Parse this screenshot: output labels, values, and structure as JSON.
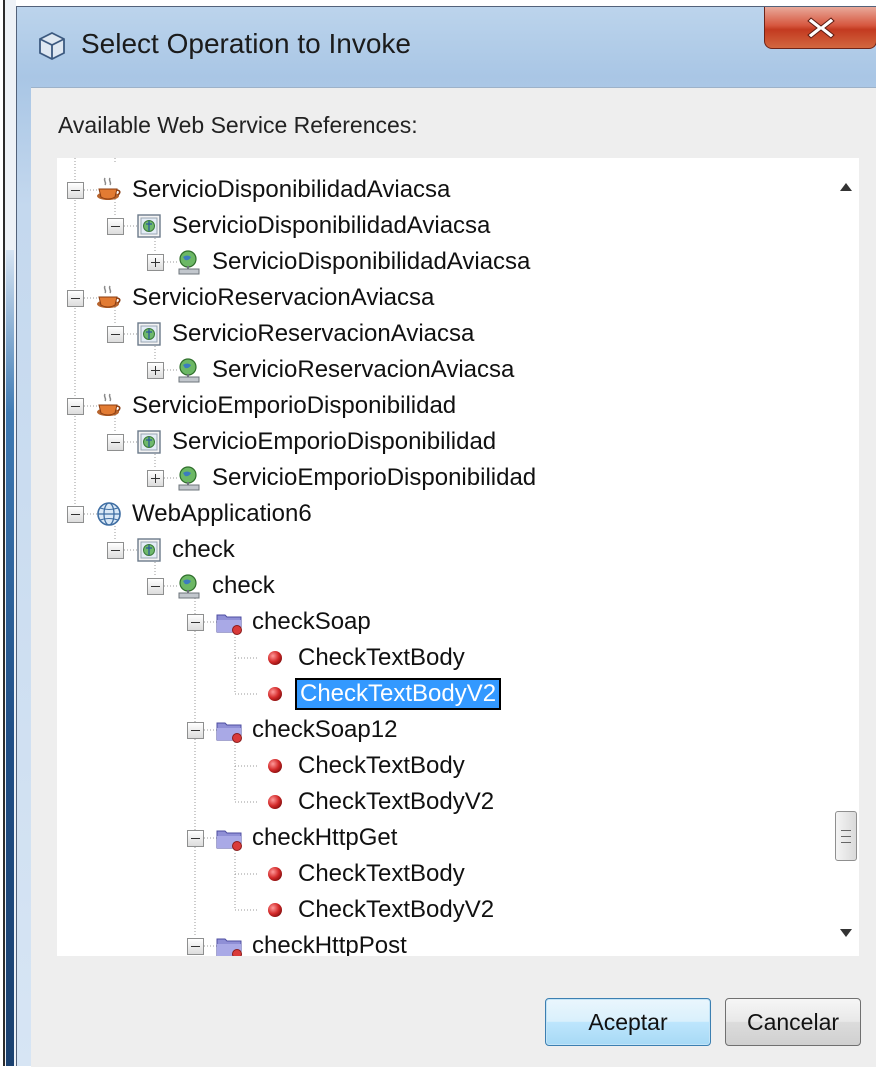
{
  "window": {
    "title": "Select Operation to Invoke",
    "title_icon": "netbeans-cube-icon",
    "close_icon": "close-x-icon"
  },
  "panel": {
    "label": "Available Web Service References:"
  },
  "tree": {
    "rows": [
      {
        "label": "ServicioDisponibilidadAviacsa",
        "icon": "coffee-cup-icon",
        "depth": 0,
        "expanded": true
      },
      {
        "label": "ServicioDisponibilidadAviacsa",
        "icon": "service-icon",
        "depth": 1,
        "expanded": true
      },
      {
        "label": "ServicioDisponibilidadAviacsa",
        "icon": "port-icon",
        "depth": 2,
        "expanded": false
      },
      {
        "label": "ServicioReservacionAviacsa",
        "icon": "coffee-cup-icon",
        "depth": 0,
        "expanded": true
      },
      {
        "label": "ServicioReservacionAviacsa",
        "icon": "service-icon",
        "depth": 1,
        "expanded": true
      },
      {
        "label": "ServicioReservacionAviacsa",
        "icon": "port-icon",
        "depth": 2,
        "expanded": false
      },
      {
        "label": "ServicioEmporioDisponibilidad",
        "icon": "coffee-cup-icon",
        "depth": 0,
        "expanded": true
      },
      {
        "label": "ServicioEmporioDisponibilidad",
        "icon": "service-icon",
        "depth": 1,
        "expanded": true
      },
      {
        "label": "ServicioEmporioDisponibilidad",
        "icon": "port-icon",
        "depth": 2,
        "expanded": false
      },
      {
        "label": "WebApplication6",
        "icon": "globe-icon",
        "depth": 0,
        "expanded": true
      },
      {
        "label": "check",
        "icon": "service-icon",
        "depth": 1,
        "expanded": true
      },
      {
        "label": "check",
        "icon": "port-icon",
        "depth": 2,
        "expanded": true
      },
      {
        "label": "checkSoap",
        "icon": "folder-icon",
        "depth": 3,
        "expanded": true
      },
      {
        "label": "CheckTextBody",
        "icon": "operation-dot-icon",
        "depth": 4
      },
      {
        "label": "CheckTextBodyV2",
        "icon": "operation-dot-icon",
        "depth": 4,
        "selected": true
      },
      {
        "label": "checkSoap12",
        "icon": "folder-icon",
        "depth": 3,
        "expanded": true
      },
      {
        "label": "CheckTextBody",
        "icon": "operation-dot-icon",
        "depth": 4
      },
      {
        "label": "CheckTextBodyV2",
        "icon": "operation-dot-icon",
        "depth": 4
      },
      {
        "label": "checkHttpGet",
        "icon": "folder-icon",
        "depth": 3,
        "expanded": true
      },
      {
        "label": "CheckTextBody",
        "icon": "operation-dot-icon",
        "depth": 4
      },
      {
        "label": "CheckTextBodyV2",
        "icon": "operation-dot-icon",
        "depth": 4
      },
      {
        "label": "checkHttpPost",
        "icon": "folder-icon",
        "depth": 3,
        "expanded": true
      }
    ]
  },
  "scrollbar": {
    "up_icon": "triangle-up-icon",
    "down_icon": "triangle-down-icon",
    "position": 0.92
  },
  "buttons": {
    "ok": "Aceptar",
    "cancel": "Cancelar"
  },
  "colors": {
    "selection": "#3399ff",
    "close_button": "#c8432a",
    "default_button": "#bee6fd"
  }
}
